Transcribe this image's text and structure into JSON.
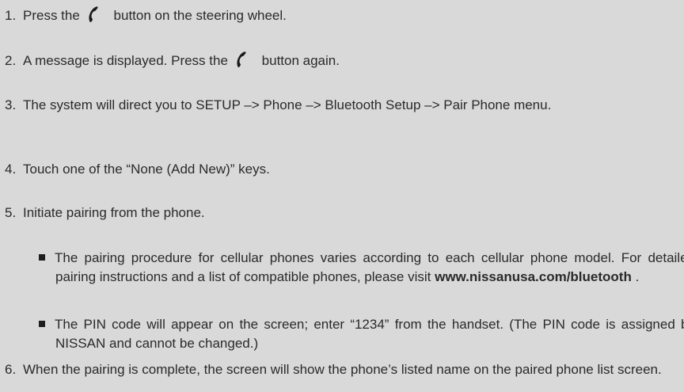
{
  "steps": [
    {
      "num": "1.",
      "before": "Press the",
      "after": "button on the steering wheel."
    },
    {
      "num": "2.",
      "before": "A message is displayed. Press the",
      "after": "button again."
    },
    {
      "num": "3.",
      "text": "The system will direct you to SETUP –> Phone –> Bluetooth Setup –> Pair Phone menu."
    },
    {
      "num": "4.",
      "text": "Touch one of the “None (Add New)” keys."
    },
    {
      "num": "5.",
      "text": "Initiate pairing from the phone."
    },
    {
      "num": "6.",
      "text": "When the pairing is complete, the screen will show the phone’s listed name on the paired phone list screen."
    }
  ],
  "bullets": [
    {
      "text": "The pairing procedure for cellular phones varies according to each cellular phone model. For detailed pairing instructions and a list of compatible phones, please visit",
      "link": "www.nissanusa.com/bluetooth",
      "suffix": "."
    },
    {
      "text": "The PIN code will appear on the screen; enter “1234” from the handset. (The PIN code is assigned by NISSAN and cannot be changed.)"
    }
  ],
  "icons": {
    "phone": "phone-handset-icon"
  },
  "colors": {
    "background": "#d9d9d9",
    "text": "#2a2a2a"
  }
}
